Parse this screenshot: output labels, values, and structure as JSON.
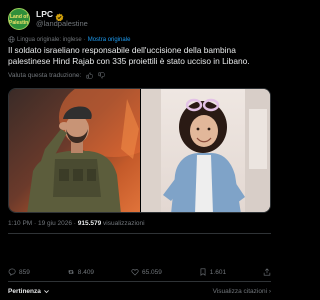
{
  "author": {
    "display_name": "LPC",
    "handle": "@landpalestine",
    "avatar_text": "Land of Palestine"
  },
  "translation": {
    "label": "Lingua originale: inglese",
    "show_original": "Mostra originale"
  },
  "tweet": {
    "text": "Il soldato israeliano responsabile dell'uccisione della bambina palestinese Hind Rajab con 335 proiettili è stato ucciso in Libano."
  },
  "rate_prompt": "Valuta questa traduzione:",
  "meta": {
    "time": "1:10 PM · 19 giu 2026 · ",
    "views": "915.579",
    "views_label": " visualizzazioni"
  },
  "actions": {
    "replies": "859",
    "reposts": "8.409",
    "likes": "65.059",
    "bookmarks": "1.601"
  },
  "bottom": {
    "left_label": "Pertinenza",
    "right_label": "Visualizza citazioni"
  },
  "colors": {
    "accent": "#1d9bf0",
    "muted": "#71767b",
    "divider": "#2f3336"
  }
}
